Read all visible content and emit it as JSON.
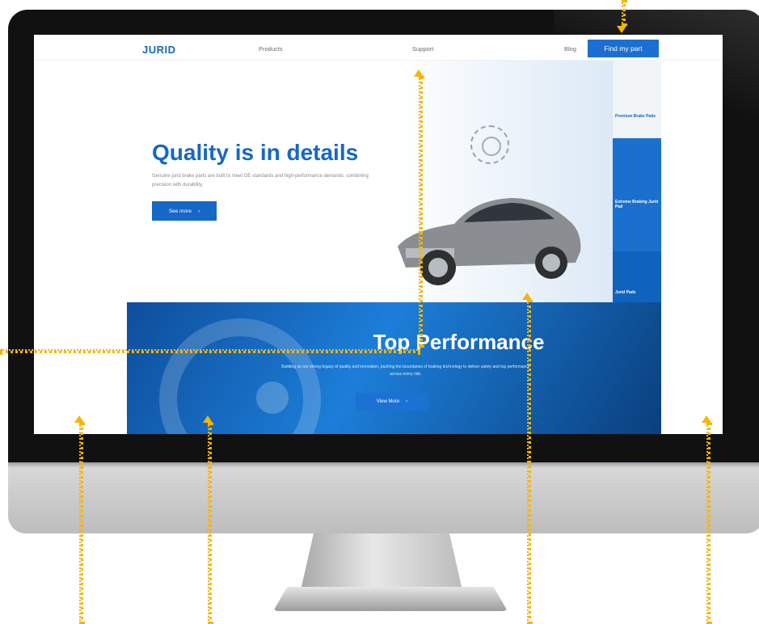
{
  "site": {
    "logo": "JURID",
    "nav": [
      "Products",
      "Support",
      "Blog"
    ],
    "cta": "Find my part"
  },
  "hero": {
    "title": "Quality is in details",
    "text": "Genuine jurid brake parts are built to meet OE standards and high-performance demands, combining precision with durability.",
    "button": "See more",
    "button_icon": "arrow-right-icon"
  },
  "side": {
    "items": [
      "Premium Brake Pads",
      "Extreme Braking Jurid Pad",
      "Jurid Pads"
    ]
  },
  "band": {
    "title": "Top Performance",
    "text": "Building on our strong legacy of quality and innovation, pushing the boundaries of braking technology to deliver safety and top performance across every ride.",
    "button": "View More",
    "button_icon": "arrow-right-icon"
  },
  "colors": {
    "brand_blue": "#1568c6",
    "callout_yellow": "#f7b500",
    "bezel": "#111111"
  }
}
